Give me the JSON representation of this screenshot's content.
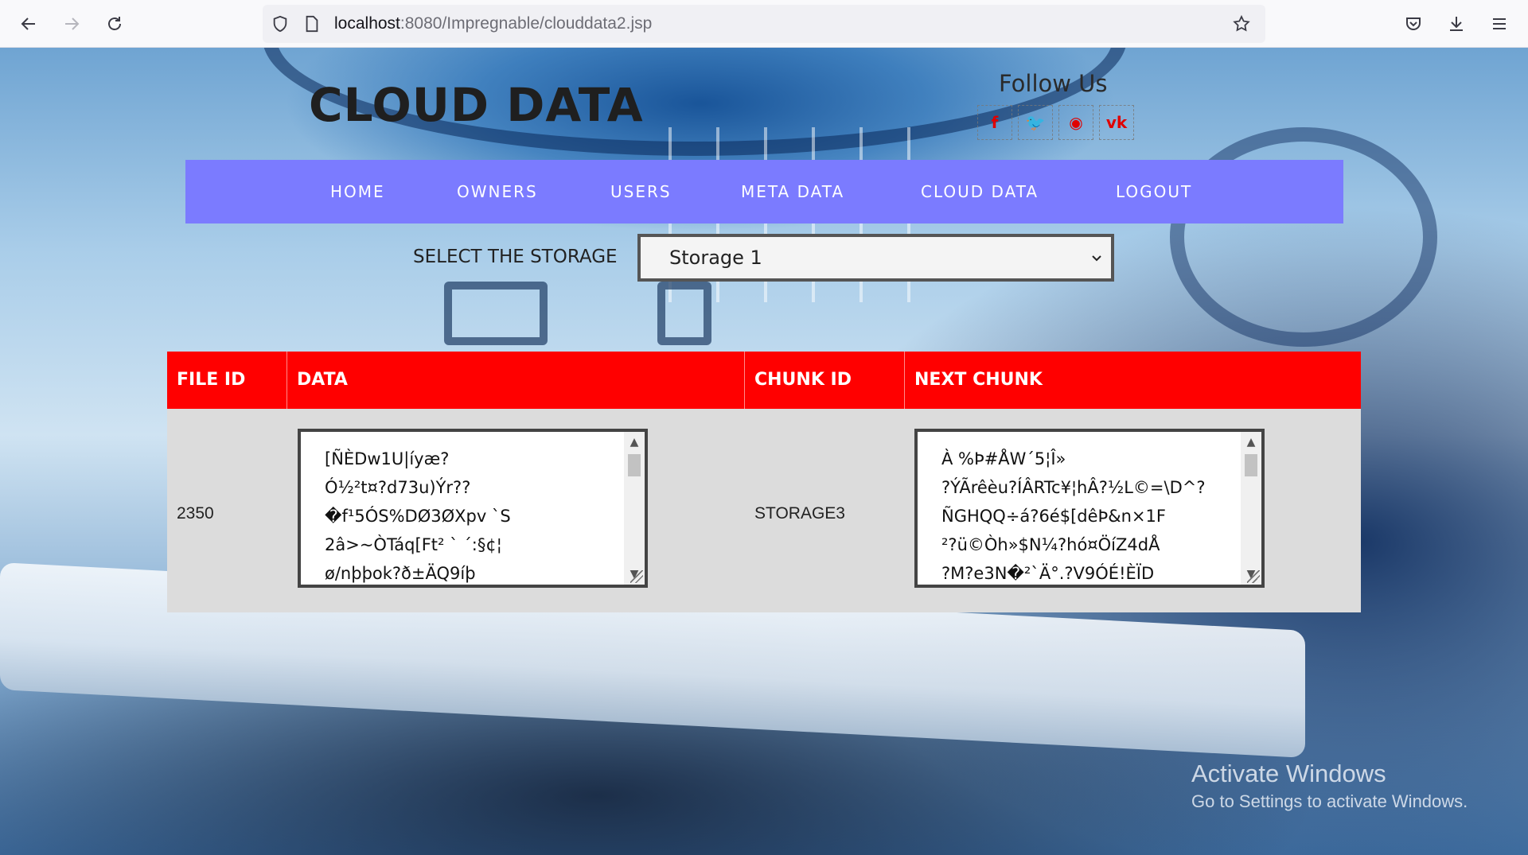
{
  "browser": {
    "url_host": "localhost",
    "url_path": ":8080/Impregnable/clouddata2.jsp",
    "icons": {
      "back": "arrow-left-icon",
      "forward": "arrow-right-icon",
      "reload": "reload-icon",
      "shield": "shield-icon",
      "page": "page-icon",
      "bookmark": "star-icon",
      "pocket": "pocket-icon",
      "downloads": "download-icon",
      "menu": "hamburger-menu-icon"
    }
  },
  "header": {
    "title": "CLOUD DATA",
    "follow_title": "Follow Us",
    "social": [
      {
        "glyph": "f",
        "icon": "facebook-icon"
      },
      {
        "glyph": "🐦",
        "icon": "twitter-icon"
      },
      {
        "glyph": "◉",
        "icon": "rss-icon"
      },
      {
        "glyph": "vk",
        "icon": "vk-icon"
      }
    ],
    "social_color": "#e00000"
  },
  "nav": {
    "background": "#7b7bff",
    "items": [
      {
        "label": "HOME"
      },
      {
        "label": "OWNERS"
      },
      {
        "label": "USERS"
      },
      {
        "label": "META DATA"
      },
      {
        "label": "CLOUD DATA"
      },
      {
        "label": "LOGOUT"
      }
    ]
  },
  "storage": {
    "label": "SELECT THE STORAGE",
    "selected": "Storage 1"
  },
  "table": {
    "header_color": "#ff0000",
    "headers": [
      "FILE ID",
      "DATA",
      "CHUNK ID",
      "NEXT CHUNK"
    ],
    "rows": [
      {
        "file_id": "2350",
        "chunk_id": "STORAGE3",
        "data_lines": [
          " [ÑÈDw1U|íyæ?",
          "Ó½²t¤?d73u)Ýr??",
          "�f¹5ÓS%DØ3ØXpv `S",
          "2â>~ÒTáq[Ft² ` ´:§¢¦",
          "ø/nþþok?ð±ÄQ9íþ"
        ],
        "next_chunk_lines": [
          " À %Þ#ÅW´5¦Î»",
          "?ÝÃrêèu?ÍÂRTc¥¦hÂ?½L©=\\D^?",
          "ÑGHQQ÷á?6é$[dêÞ&n×1F",
          "²?ü©Òh»$N¼?hó¤ÖíZ4dÅ",
          "?M?e3N�²`Ä°.?V9ÓÉ!ÈÏD"
        ]
      }
    ]
  },
  "watermark": {
    "title": "Activate Windows",
    "subtitle": "Go to Settings to activate Windows."
  }
}
